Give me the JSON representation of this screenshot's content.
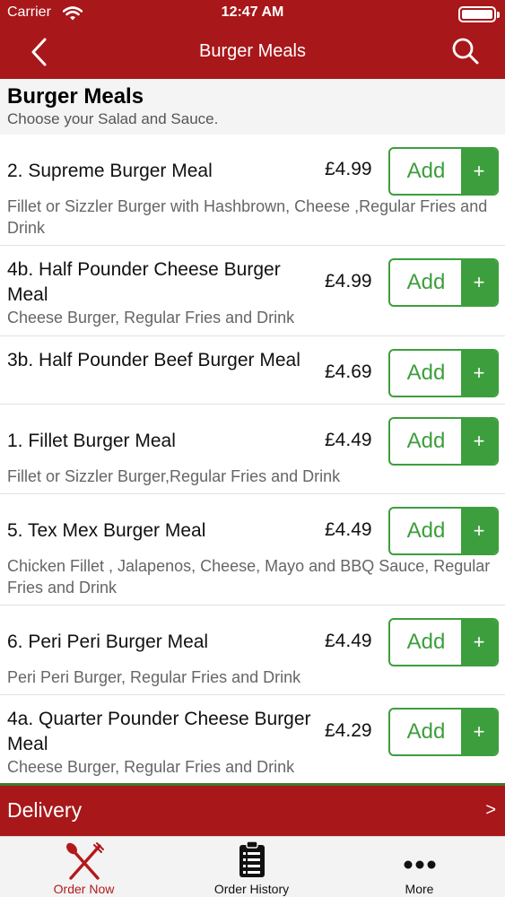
{
  "status_bar": {
    "carrier": "Carrier",
    "time": "12:47 AM"
  },
  "nav": {
    "title": "Burger Meals",
    "back_icon": "chevron-left-icon",
    "search_icon": "search-icon"
  },
  "section": {
    "title": "Burger Meals",
    "subtitle": "Choose your Salad and Sauce."
  },
  "items": [
    {
      "name": "2. Supreme Burger Meal",
      "price": "£4.99",
      "description": "Fillet or Sizzler Burger with Hashbrown, Cheese ,Regular Fries and Drink",
      "add_label": "Add",
      "plus_label": "+"
    },
    {
      "name": "4b. Half Pounder Cheese Burger Meal",
      "price": "£4.99",
      "description": "Cheese Burger, Regular Fries and Drink",
      "add_label": "Add",
      "plus_label": "+"
    },
    {
      "name": "3b. Half Pounder Beef Burger Meal",
      "price": "£4.69",
      "description": "",
      "add_label": "Add",
      "plus_label": "+"
    },
    {
      "name": "1. Fillet Burger Meal",
      "price": "£4.49",
      "description": "Fillet or Sizzler Burger,Regular Fries and Drink",
      "add_label": "Add",
      "plus_label": "+"
    },
    {
      "name": "5. Tex Mex Burger Meal",
      "price": "£4.49",
      "description": "Chicken Fillet , Jalapenos, Cheese, Mayo and BBQ Sauce, Regular Fries and Drink",
      "add_label": "Add",
      "plus_label": "+"
    },
    {
      "name": "6. Peri Peri Burger Meal",
      "price": "£4.49",
      "description": "Peri Peri Burger, Regular Fries and Drink",
      "add_label": "Add",
      "plus_label": "+"
    },
    {
      "name": "4a. Quarter Pounder Cheese Burger Meal",
      "price": "£4.29",
      "description": "Cheese Burger, Regular Fries and Drink",
      "add_label": "Add",
      "plus_label": "+"
    }
  ],
  "delivery": {
    "label": "Delivery",
    "arrow": ">"
  },
  "tabs": [
    {
      "label": "Order Now",
      "icon": "fork-knife-icon",
      "active": true
    },
    {
      "label": "Order History",
      "icon": "clipboard-list-icon",
      "active": false
    },
    {
      "label": "More",
      "icon": "more-dots-icon",
      "active": false
    }
  ],
  "colors": {
    "brand_red": "#a8171a",
    "add_green": "#3d9e3d",
    "active_tab": "#b3191c"
  }
}
